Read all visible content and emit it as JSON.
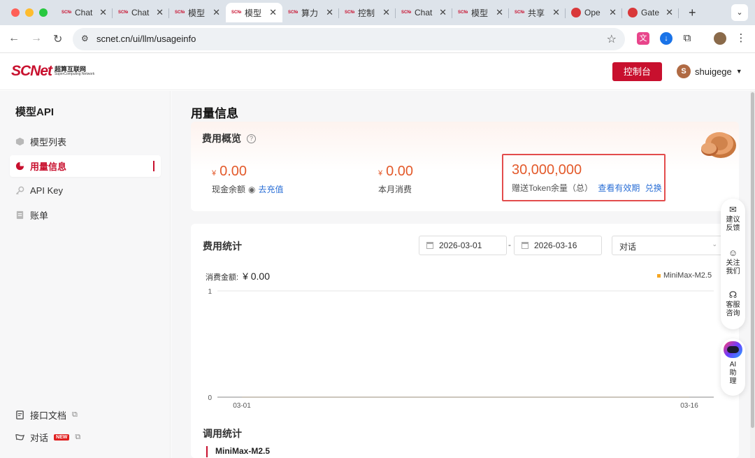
{
  "browser": {
    "tabs": [
      {
        "title": "Chat",
        "favicon": "scnet"
      },
      {
        "title": "Chat",
        "favicon": "scnet"
      },
      {
        "title": "模型",
        "favicon": "scnet"
      },
      {
        "title": "模型",
        "favicon": "scnet",
        "active": true
      },
      {
        "title": "算力",
        "favicon": "scnet"
      },
      {
        "title": "控制",
        "favicon": "scnet"
      },
      {
        "title": "Chat",
        "favicon": "scnet"
      },
      {
        "title": "模型",
        "favicon": "scnet"
      },
      {
        "title": "共享",
        "favicon": "scnet"
      },
      {
        "title": "Ope",
        "favicon": "red-round"
      },
      {
        "title": "Gate",
        "favicon": "red-round"
      }
    ],
    "favicon_text": "SCNet",
    "url": "scnet.cn/ui/llm/usageinfo"
  },
  "header": {
    "logo": "SCNet",
    "logo_cn": "超算互联网",
    "logo_en": "SuperComputing Network",
    "console_label": "控制台",
    "avatar_letter": "S",
    "username": "shuigege"
  },
  "sidebar": {
    "title": "模型API",
    "items": [
      {
        "label": "模型列表",
        "icon": "cube-icon"
      },
      {
        "label": "用量信息",
        "icon": "pie-chart-icon",
        "active": true
      },
      {
        "label": "API Key",
        "icon": "key-icon"
      },
      {
        "label": "账单",
        "icon": "bill-icon"
      }
    ],
    "bottom": [
      {
        "label": "接口文档",
        "icon": "book-icon"
      },
      {
        "label": "对话",
        "icon": "chat-icon",
        "badge": "NEW"
      }
    ]
  },
  "main": {
    "title": "用量信息",
    "overview": {
      "title": "费用概览",
      "currency": "¥",
      "cash_balance": "0.00",
      "cash_label": "现金余额",
      "recharge": "去充值",
      "month_spend": "0.00",
      "month_label": "本月消费",
      "token_balance": "30,000,000",
      "token_label": "赠送Token余量（总）",
      "validity_link": "查看有效期",
      "redeem_link": "兑换"
    },
    "stats": {
      "title": "费用统计",
      "date_from": "2026-03-01",
      "date_sep": "-",
      "date_to": "2026-03-16",
      "type_select": "对话",
      "spend_label": "消费金额:",
      "spend_value": "¥ 0.00"
    },
    "calls": {
      "title": "调用统计",
      "model": "MiniMax-M2.5"
    }
  },
  "float": {
    "feedback": "建议\n反馈",
    "follow": "关注\n我们",
    "service": "客服\n咨询",
    "ai": "AI\n助\n理"
  },
  "chart_data": {
    "type": "line",
    "x": [
      "03-01",
      "03-16"
    ],
    "series": [
      {
        "name": "MiniMax-M2.5",
        "values": [
          0,
          0
        ],
        "color": "#f5a623"
      }
    ],
    "ylim": [
      0,
      1
    ],
    "yticks": [
      "0",
      "1"
    ],
    "legend": "top-right",
    "grid": true
  }
}
